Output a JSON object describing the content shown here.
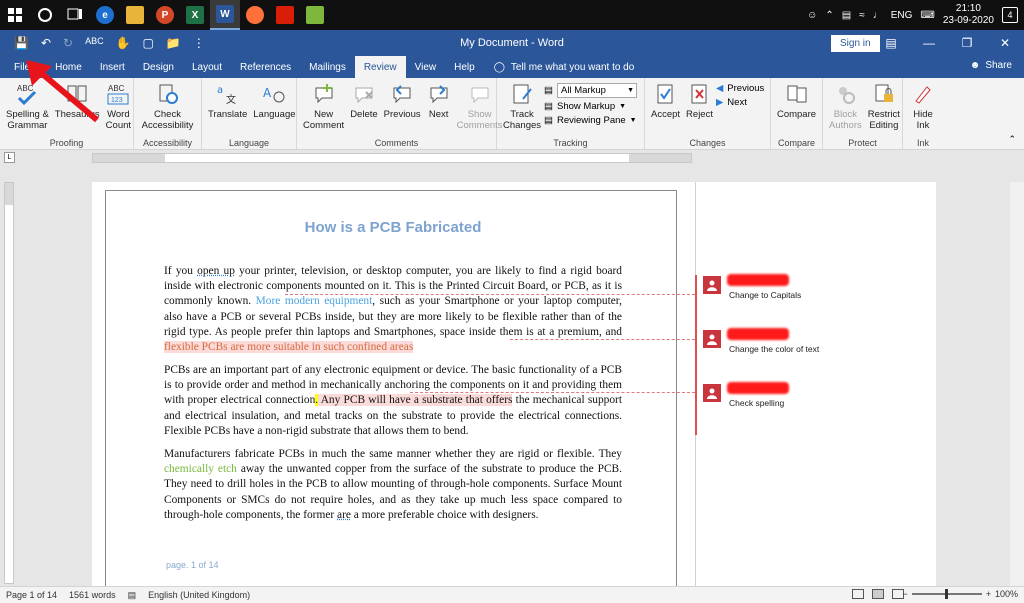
{
  "taskbar": {
    "time": "21:10",
    "date": "23-09-2020",
    "lang": "ENG",
    "notifications": "4",
    "apps": [
      {
        "name": "edge",
        "color": "#1e6fd0",
        "glyph": "e"
      },
      {
        "name": "explorer",
        "color": "#e8b43a",
        "glyph": ""
      },
      {
        "name": "powerpoint",
        "color": "#d24726",
        "glyph": "P"
      },
      {
        "name": "excel",
        "color": "#1e7145",
        "glyph": "X"
      },
      {
        "name": "word",
        "color": "#2b579a",
        "glyph": "W"
      },
      {
        "name": "firefox",
        "color": "#ff7139",
        "glyph": ""
      },
      {
        "name": "acrobat",
        "color": "#d81e05",
        "glyph": ""
      },
      {
        "name": "notepad",
        "color": "#7fb63c",
        "glyph": ""
      }
    ]
  },
  "titlebar": {
    "title": "My Document  -  Word",
    "sign_in": "Sign in"
  },
  "tabs": [
    "File",
    "Home",
    "Insert",
    "Design",
    "Layout",
    "References",
    "Mailings",
    "Review",
    "View",
    "Help"
  ],
  "active_tab": "Review",
  "tell_me": "Tell me what you want to do",
  "share": "Share",
  "ribbon": {
    "proofing": {
      "label": "Proofing",
      "spelling": "Spelling &\nGrammar",
      "thesaurus": "Thesaurus",
      "word_count": "Word\nCount"
    },
    "accessibility": {
      "label": "Accessibility",
      "check": "Check\nAccessibility"
    },
    "language": {
      "label": "Language",
      "translate": "Translate",
      "language": "Language"
    },
    "comments": {
      "label": "Comments",
      "new": "New\nComment",
      "delete": "Delete",
      "previous": "Previous",
      "next": "Next",
      "show": "Show\nComments"
    },
    "tracking": {
      "label": "Tracking",
      "track": "Track\nChanges",
      "all_markup": "All Markup",
      "show_markup": "Show Markup",
      "reviewing_pane": "Reviewing Pane"
    },
    "changes": {
      "label": "Changes",
      "accept": "Accept",
      "reject": "Reject",
      "previous": "Previous",
      "next": "Next"
    },
    "compare": {
      "label": "Compare",
      "compare": "Compare"
    },
    "protect": {
      "label": "Protect",
      "block": "Block\nAuthors",
      "restrict": "Restrict\nEditing"
    },
    "ink": {
      "label": "Ink",
      "hide": "Hide\nInk"
    }
  },
  "document": {
    "heading": "How is a PCB Fabricated",
    "p1": {
      "a": "If you ",
      "b": "open up",
      "c": " your printer, television, or desktop computer, you are likely to find a rigid board inside with electronic components mounted on it. This is the Printed Circuit Board, or PCB, as it is commonly known. ",
      "blue": "More modern equipment",
      "d": ", such as your Smartphone or your laptop computer, also have a PCB or several PCBs inside, but they are more likely to be flexible rather than of the rigid type. As people prefer thin laptops and Smartphones, space inside them is at a premium, and ",
      "orange": "flexible PCBs are more suitable in such confined areas"
    },
    "p2": {
      "a": "PCBs are an important part of any electronic equipment or device. The basic functionality of a PCB is to provide order and method in mechanically anchoring the components on it and providing them with proper electrical connection",
      "hl": ".",
      "ins": " Any PCB will have a substrate that offers",
      "b": " the mechanical support and electrical insulation, and metal tracks on the substrate to provide the electrical connections. Flexible PCBs have a non-rigid substrate that allows them to bend."
    },
    "p3": {
      "a": "Manufacturers fabricate PCBs in much the same manner whether they are rigid or flexible. They ",
      "green": "chemically etch",
      "b": " away the unwanted copper from the surface of the substrate to produce the PCB. They need to drill holes in the PCB to allow mounting of through-hole components. Surface Mount Components or SMCs do not require holes, and as they take up much less space compared to through-hole components, the former ",
      "c": "are",
      "d": " a more preferable choice with designers."
    },
    "page_footer": "page. 1 of 14"
  },
  "comments": [
    {
      "text": "Change to Capitals"
    },
    {
      "text": "Change the color of text"
    },
    {
      "text": "Check spelling"
    }
  ],
  "status": {
    "page": "Page 1 of 14",
    "words": "1561 words",
    "language": "English (United Kingdom)",
    "zoom": "100%"
  }
}
